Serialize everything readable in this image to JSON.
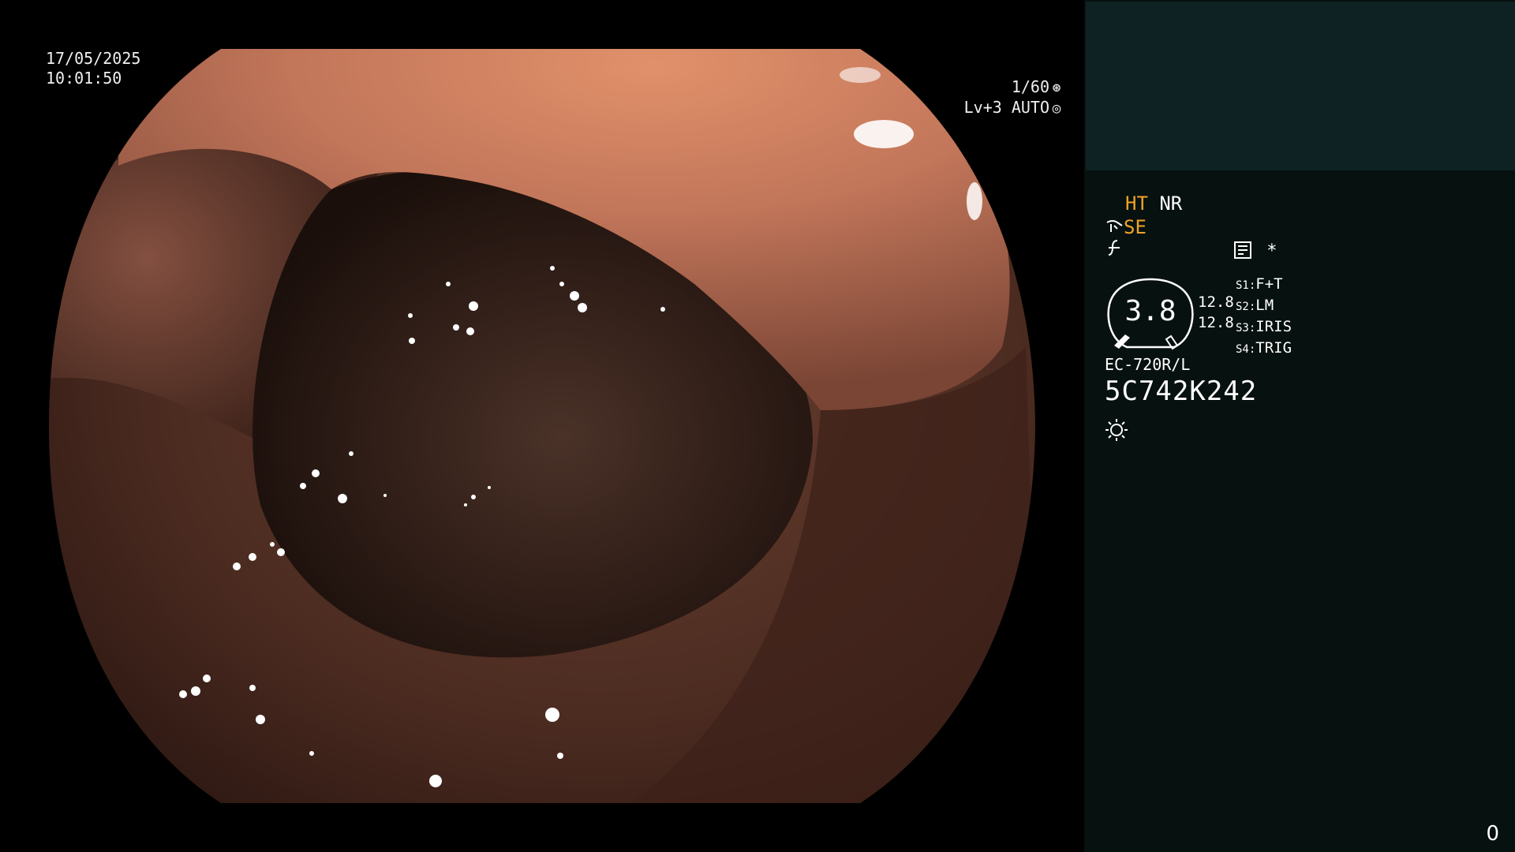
{
  "overlay": {
    "date": "17/05/2025",
    "time": "10:01:50",
    "shutter": "1/60",
    "shutter_icon": "shutter-icon",
    "level": "Lv+3 AUTO",
    "level_icon": "iris-icon"
  },
  "panel": {
    "mode_ht": "HT",
    "mode_nr": "NR",
    "mode_se": "SE",
    "se_icon": "scope-tip-icon",
    "edge_icon": "edge-enhance-icon",
    "memo_icon": "memo-icon",
    "star": "*",
    "gauge_value": "3.8",
    "readout_1": "12.8",
    "readout_2": "12.8",
    "switches": [
      {
        "key": "S1:",
        "value": "F+T"
      },
      {
        "key": "S2:",
        "value": "LM"
      },
      {
        "key": "S3:",
        "value": "IRIS"
      },
      {
        "key": "S4:",
        "value": "TRIG"
      }
    ],
    "scope_model": "EC-720R/L",
    "scope_serial": "5C742K242",
    "light_icon": "light-source-icon",
    "counter": "0",
    "colors": {
      "accent": "#f0a32a",
      "panel_bg": "#07110f",
      "patient_box": "#0e2223"
    }
  }
}
